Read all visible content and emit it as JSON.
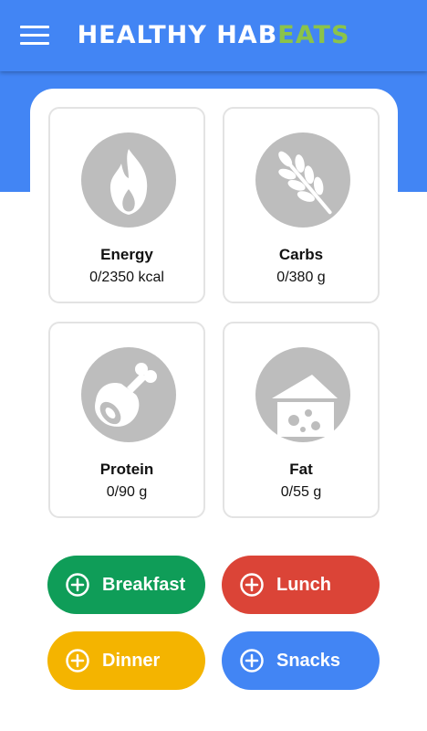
{
  "app": {
    "title_main": "HEALTHY HAB",
    "title_accent": "EATS",
    "colors": {
      "primary": "#4285f4",
      "accent": "#8bc34a",
      "icon_gray": "#bdbdbd"
    }
  },
  "header": {
    "menu_icon": "hamburger-menu-icon"
  },
  "nutrients": [
    {
      "name": "Energy",
      "value": "0/2350 kcal",
      "icon": "flame-icon"
    },
    {
      "name": "Carbs",
      "value": "0/380 g",
      "icon": "wheat-icon"
    },
    {
      "name": "Protein",
      "value": "0/90 g",
      "icon": "meat-drumstick-icon"
    },
    {
      "name": "Fat",
      "value": "0/55 g",
      "icon": "cheese-icon"
    }
  ],
  "meals": [
    {
      "label": "Breakfast",
      "color": "#0f9d58",
      "icon": "plus-circle-icon"
    },
    {
      "label": "Lunch",
      "color": "#db4437",
      "icon": "plus-circle-icon"
    },
    {
      "label": "Dinner",
      "color": "#f4b400",
      "icon": "plus-circle-icon"
    },
    {
      "label": "Snacks",
      "color": "#4285f4",
      "icon": "plus-circle-icon"
    }
  ]
}
